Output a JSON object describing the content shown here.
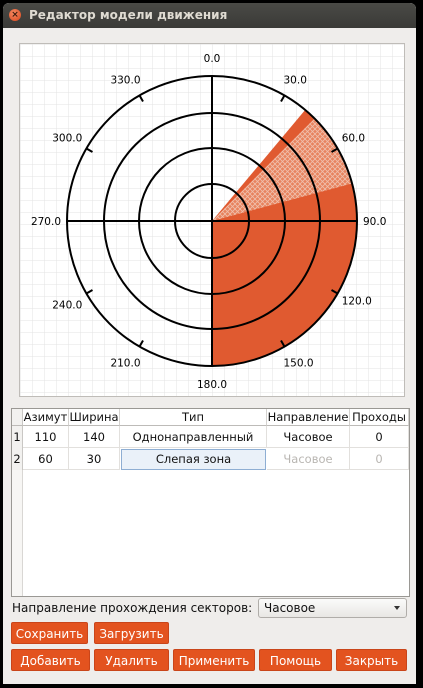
{
  "window": {
    "title": "Редактор модели движения"
  },
  "icons": {
    "close": "close-icon"
  },
  "colors": {
    "accent": "#e3531f",
    "sector": "#e05a30"
  },
  "polar_plot": {
    "angle_labels": [
      "0.0",
      "30.0",
      "60.0",
      "90.0",
      "120.0",
      "150.0",
      "180.0",
      "210.0",
      "240.0",
      "270.0",
      "300.0",
      "330.0"
    ],
    "sectors": [
      {
        "azimuth": 110,
        "width": 140,
        "style": "solid"
      },
      {
        "azimuth": 60,
        "width": 30,
        "style": "hatched"
      }
    ]
  },
  "table": {
    "headers": [
      "Азимут",
      "Ширина",
      "Тип",
      "Направление",
      "Проходы"
    ],
    "rows": [
      {
        "num": "1",
        "azimuth": "110",
        "width": "140",
        "type": "Однонаправленный",
        "direction": "Часовое",
        "passes": "0"
      },
      {
        "num": "2",
        "azimuth": "60",
        "width": "30",
        "type": "Слепая зона",
        "direction": "Часовое",
        "passes": "0"
      }
    ]
  },
  "direction_label": "Направление прохождения секторов:",
  "direction_value": "Часовое",
  "buttons": {
    "save": "Сохранить",
    "load": "Загрузить",
    "add": "Добавить",
    "delete": "Удалить",
    "apply": "Применить",
    "help": "Помощь",
    "close": "Закрыть"
  }
}
